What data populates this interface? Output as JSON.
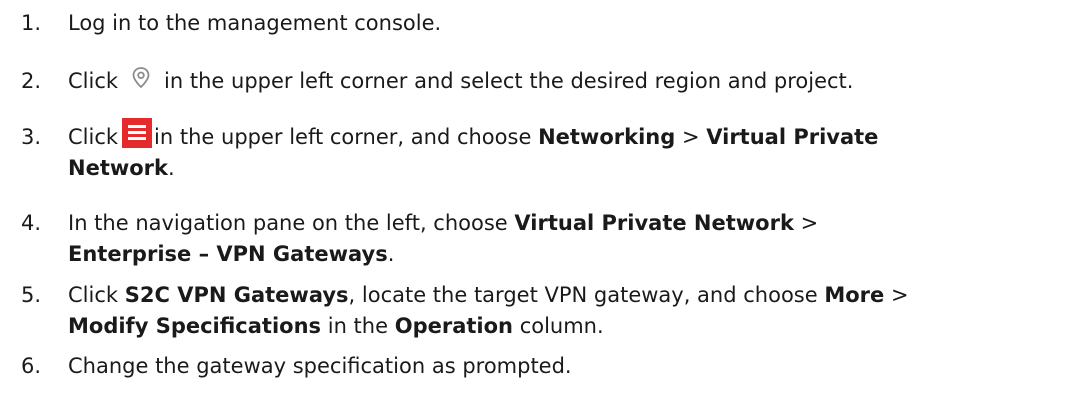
{
  "steps": [
    {
      "number": "1.",
      "text": "Log in to the management console."
    },
    {
      "number": "2.",
      "before_icon": "Click",
      "icon": "location-pin-icon",
      "after_icon": "in the upper left corner and select the desired region and project."
    },
    {
      "number": "3.",
      "before_icon": "Click",
      "icon": "menu-icon",
      "after_icon": "in the upper left corner, and choose",
      "bold_1": "Networking",
      "sep": ">",
      "bold_2a": "Virtual Private",
      "bold_2b": "Network",
      "end": "."
    },
    {
      "number": "4.",
      "prefix": "In the navigation pane on the left, choose",
      "bold_1": "Virtual Private Network",
      "sep": ">",
      "bold_2": "Enterprise – VPN Gateways",
      "end": "."
    },
    {
      "number": "5.",
      "prefix": "Click",
      "bold_1": "S2C VPN Gateways",
      "mid_1": ", locate the target VPN gateway, and choose",
      "bold_2": "More",
      "sep": ">",
      "bold_3": "Modify Specifications",
      "mid_2": "in the",
      "bold_4": "Operation",
      "end": "column."
    },
    {
      "number": "6.",
      "text": "Change the gateway specification as prompted."
    }
  ],
  "colors": {
    "text": "#1a1a1a",
    "menu_icon_bg": "#e42a2a",
    "pin_icon": "#8c8c8c"
  }
}
